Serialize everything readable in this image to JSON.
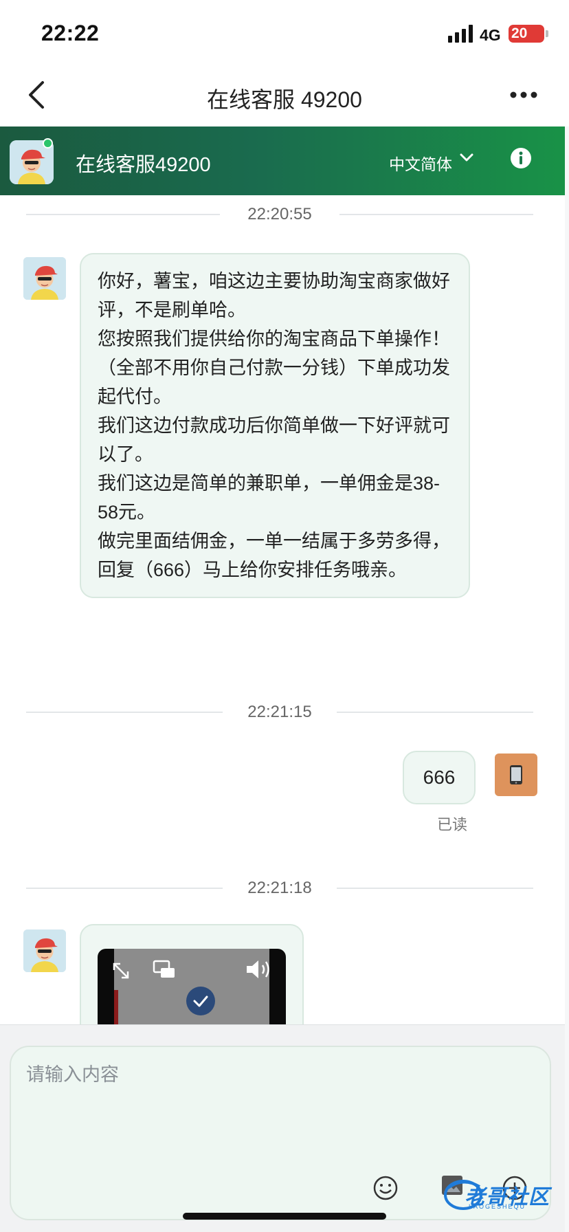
{
  "status_bar": {
    "time": "22:22",
    "network": "4G",
    "battery": "20"
  },
  "nav": {
    "title": "在线客服 49200"
  },
  "chat_header": {
    "agent_name": "在线客服49200",
    "language": "中文简体"
  },
  "messages": {
    "ts1": "22:20:55",
    "msg1_lines": [
      "你好，薯宝，咱这边主要协助淘宝商家做好评，不是刷单哈。",
      "您按照我们提供给你的淘宝商品下单操作！",
      "（全部不用你自己付款一分钱）下单成功发起代付。",
      "我们这边付款成功后你简单做一下好评就可以了。",
      "我们这边是简单的兼职单，一单佣金是38-58元。",
      "做完里面结佣金，一单一结属于多劳多得，回复（666）马上给你安排任务哦亲。"
    ],
    "ts2": "22:21:15",
    "user_msg": "666",
    "read_status": "已读",
    "ts3": "22:21:18"
  },
  "input": {
    "placeholder": "请输入内容"
  },
  "watermark": {
    "text": "老哥社区",
    "sub": "LAOGESHEQU"
  },
  "colors": {
    "header_gradient_start": "#1b5a3f",
    "header_gradient_end": "#199247",
    "bubble_bg": "#eff7f3",
    "user_avatar": "#de935c",
    "battery": "#e03a36"
  },
  "icons": [
    "signal-icon",
    "back-icon",
    "more-icon",
    "online-dot",
    "chevron-down-icon",
    "info-icon",
    "expand-icon",
    "pip-icon",
    "volume-icon",
    "check-icon",
    "phone-icon",
    "emoji-icon",
    "image-icon",
    "plus-icon"
  ]
}
